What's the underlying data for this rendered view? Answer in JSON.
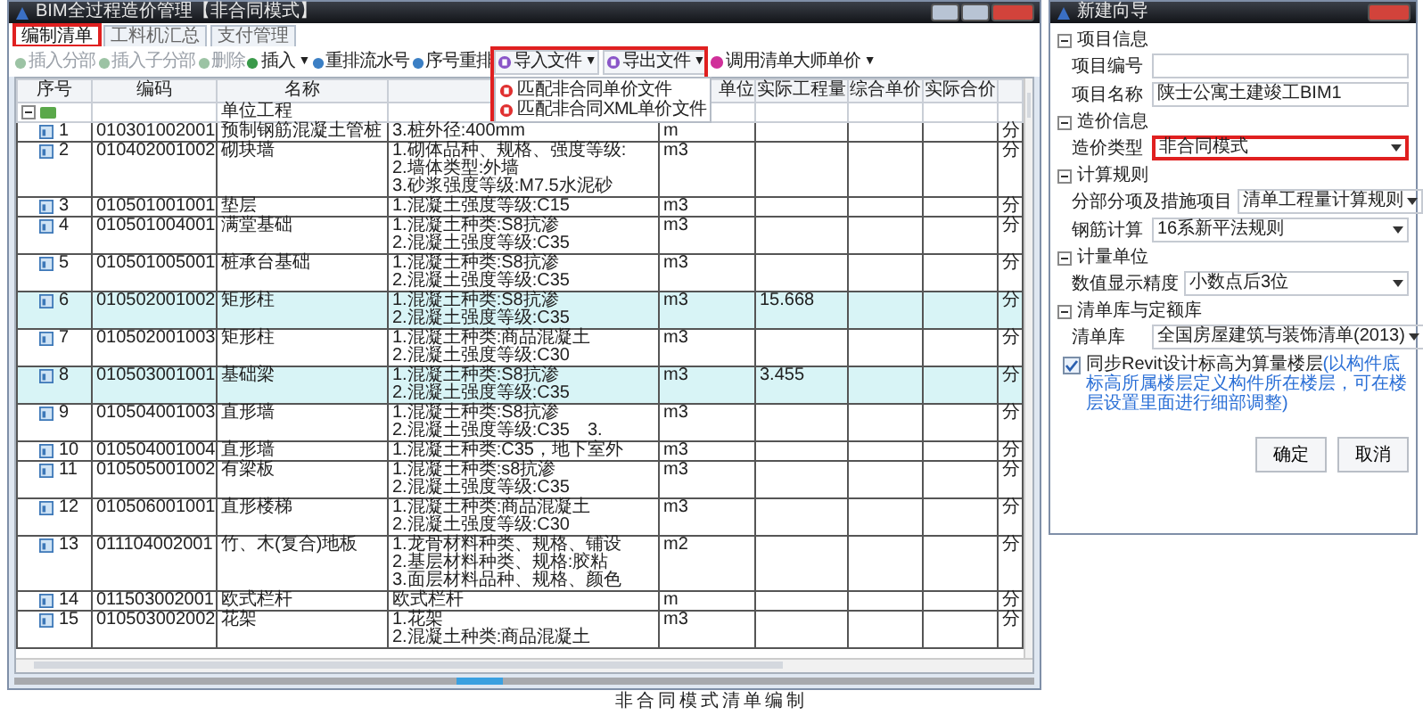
{
  "window": {
    "title": "BIM全过程造价管理【非合同模式】"
  },
  "tabs": [
    {
      "label": "编制清单",
      "selected": true,
      "highlighted": true
    },
    {
      "label": "工料机汇总",
      "selected": false,
      "highlighted": false
    },
    {
      "label": "支付管理",
      "selected": false,
      "highlighted": false
    }
  ],
  "toolbar": [
    {
      "label": "插入分部",
      "disabled": true
    },
    {
      "label": "插入子分部",
      "disabled": true
    },
    {
      "label": "删除",
      "disabled": true
    },
    {
      "label": "插入",
      "disabled": false,
      "arrow": "▼"
    },
    {
      "label": "重排流水号",
      "disabled": false
    },
    {
      "label": "序号重排",
      "disabled": false
    }
  ],
  "file_buttons": [
    {
      "label": "导入文件",
      "arrow": "▼"
    },
    {
      "label": "导出文件",
      "arrow": "▼"
    }
  ],
  "file_menu": {
    "highlighted": true,
    "items": [
      "匹配非合同单价文件",
      "匹配非合同XML单价文件"
    ]
  },
  "price_button": {
    "label": "调用清单大师单价",
    "arrow": "▼"
  },
  "table": {
    "columns": [
      "序号",
      "编码",
      "名称",
      "单位",
      "实际工程量",
      "综合单价",
      "实际合价"
    ],
    "root": {
      "name": "单位工程",
      "expanded": true
    },
    "rows": [
      {
        "no": "1",
        "code": "010301002001",
        "name": "预制钢筋混凝土管桩",
        "features": [
          "3.桩外径:400mm"
        ],
        "unit": "m",
        "column_9": "分",
        "selected": false
      },
      {
        "no": "2",
        "code": "010402001002",
        "name": "砌块墙",
        "features": [
          "1.砌体品种、规格、强度等级:",
          "2.墙体类型:外墙",
          "3.砂浆强度等级:M7.5水泥砂"
        ],
        "unit": "m3",
        "column_9": "分",
        "selected": false
      },
      {
        "no": "3",
        "code": "010501001001",
        "name": "垫层",
        "features": [
          "1.混凝土强度等级:C15"
        ],
        "unit": "m3",
        "column_9": "分",
        "selected": false
      },
      {
        "no": "4",
        "code": "010501004001",
        "name": "满堂基础",
        "features": [
          "1.混凝土种类:S8抗渗",
          "2.混凝土强度等级:C35"
        ],
        "unit": "m3",
        "column_9": "分",
        "selected": false
      },
      {
        "no": "5",
        "code": "010501005001",
        "name": "桩承台基础",
        "features": [
          "1.混凝土种类:S8抗渗",
          "2.混凝土强度等级:C35"
        ],
        "unit": "m3",
        "column_9": "分",
        "selected": false
      },
      {
        "no": "6",
        "code": "010502001002",
        "name": "矩形柱",
        "features": [
          "1.混凝土种类:S8抗渗",
          "2.混凝土强度等级:C35"
        ],
        "unit": "m3",
        "quantity": "15.668",
        "column_9": "分",
        "selected": true
      },
      {
        "no": "7",
        "code": "010502001003",
        "name": "矩形柱",
        "features": [
          "1.混凝土种类:商品混凝土",
          "2.混凝土强度等级:C30"
        ],
        "unit": "m3",
        "column_9": "分",
        "selected": false
      },
      {
        "no": "8",
        "code": "010503001001",
        "name": "基础梁",
        "features": [
          "1.混凝土种类:S8抗渗",
          "2.混凝土强度等级:C35"
        ],
        "unit": "m3",
        "quantity": "3.455",
        "column_9": "分",
        "selected": true
      },
      {
        "no": "9",
        "code": "010504001003",
        "name": "直形墙",
        "features": [
          "1.混凝土种类:S8抗渗",
          "2.混凝土强度等级:C35　3."
        ],
        "unit": "m3",
        "column_9": "分",
        "selected": false
      },
      {
        "no": "10",
        "code": "010504001004",
        "name": "直形墙",
        "features": [
          "1.混凝土种类:C35，地下室外"
        ],
        "unit": "m3",
        "column_9": "分",
        "selected": false
      },
      {
        "no": "11",
        "code": "010505001002",
        "name": "有梁板",
        "features": [
          "1.混凝土种类:s8抗渗",
          "2.混凝土强度等级:C35"
        ],
        "unit": "m3",
        "column_9": "分",
        "selected": false
      },
      {
        "no": "12",
        "code": "010506001001",
        "name": "直形楼梯",
        "features": [
          "1.混凝土种类:商品混凝土",
          "2.混凝土强度等级:C30"
        ],
        "unit": "m3",
        "column_9": "分",
        "selected": false
      },
      {
        "no": "13",
        "code": "011104002001",
        "name": "竹、木(复合)地板",
        "features": [
          "1.龙骨材料种类、规格、铺设",
          "2.基层材料种类、规格:胶粘",
          "3.面层材料品种、规格、颜色"
        ],
        "unit": "m2",
        "column_9": "分",
        "selected": false
      },
      {
        "no": "14",
        "code": "011503002001",
        "name": "欧式栏杆",
        "features": [
          "欧式栏杆"
        ],
        "unit": "m",
        "column_9": "分",
        "selected": false
      },
      {
        "no": "15",
        "code": "010503002002",
        "name": "花架",
        "features": [
          "1.花架",
          "2.混凝土种类:商品混凝土"
        ],
        "unit": "m3",
        "column_9": "分",
        "selected": false
      }
    ]
  },
  "dialog": {
    "title": "新建向导",
    "sections": [
      {
        "title": "项目信息",
        "expanded": true,
        "fields": [
          {
            "label": "项目编号",
            "kind": "text",
            "highlighted": false
          },
          {
            "label": "项目名称",
            "kind": "text",
            "value": "陕士公寓土建竣工BIM1",
            "highlighted": false
          }
        ]
      },
      {
        "title": "造价信息",
        "expanded": true,
        "fields": [
          {
            "label": "造价类型",
            "kind": "select",
            "value": "非合同模式",
            "highlighted": true
          }
        ]
      },
      {
        "title": "计算规则",
        "expanded": true,
        "fields": [
          {
            "label": "分部分项及措施项目",
            "kind": "select",
            "value": "清单工程量计算规则",
            "highlighted": false
          },
          {
            "label": "钢筋计算",
            "kind": "select",
            "value": "16系新平法规则",
            "highlighted": false
          }
        ]
      },
      {
        "title": "计量单位",
        "expanded": true,
        "fields": [
          {
            "label": "数值显示精度",
            "kind": "select",
            "value": "小数点后3位",
            "highlighted": false
          }
        ]
      },
      {
        "title": "清单库与定额库",
        "expanded": true,
        "fields": [
          {
            "label": "清单库",
            "kind": "select",
            "value": "全国房屋建筑与装饰清单(2013)",
            "highlighted": false
          }
        ]
      }
    ],
    "sync_option": {
      "checked": true,
      "label": "同步Revit设计标高为算量楼层",
      "note": "(以构件底标高所属楼层定义构件所在楼层，可在楼层设置里面进行细部调整)"
    },
    "buttons": [
      "确定",
      "取消"
    ]
  },
  "caption": "非合同模式清单编制"
}
